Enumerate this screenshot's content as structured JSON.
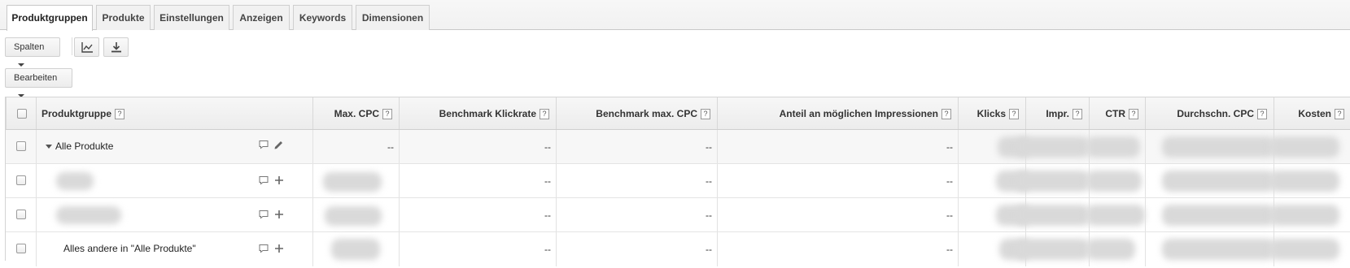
{
  "tabs": [
    {
      "label": "Produktgruppen",
      "active": true
    },
    {
      "label": "Produkte"
    },
    {
      "label": "Einstellungen"
    },
    {
      "label": "Anzeigen"
    },
    {
      "label": "Keywords"
    },
    {
      "label": "Dimensionen"
    }
  ],
  "toolbar": {
    "columns_label": "Spalten",
    "chart_icon": "line-chart-icon",
    "download_icon": "download-icon",
    "edit_label": "Bearbeiten"
  },
  "table": {
    "help_glyph": "?",
    "headers": {
      "produktgruppe": "Produktgruppe",
      "max_cpc": "Max. CPC",
      "benchmark_ctr": "Benchmark Klickrate",
      "benchmark_max_cpc": "Benchmark max. CPC",
      "impression_share": "Anteil an möglichen Impressionen",
      "clicks": "Klicks",
      "impr": "Impr.",
      "ctr": "CTR",
      "avg_cpc": "Durchschn. CPC",
      "cost": "Kosten"
    },
    "placeholder": "--",
    "rows": [
      {
        "name": "Alle Produkte",
        "max_cpc": "--",
        "benchmark_ctr": "--",
        "benchmark_max_cpc": "--",
        "impression_share": "--"
      },
      {
        "name": "",
        "benchmark_ctr": "--",
        "benchmark_max_cpc": "--",
        "impression_share": "--"
      },
      {
        "name": "",
        "benchmark_ctr": "--",
        "benchmark_max_cpc": "--",
        "impression_share": "--"
      },
      {
        "name": "Alles andere in \"Alle Produkte\"",
        "benchmark_ctr": "--",
        "benchmark_max_cpc": "--",
        "impression_share": "--"
      }
    ]
  }
}
